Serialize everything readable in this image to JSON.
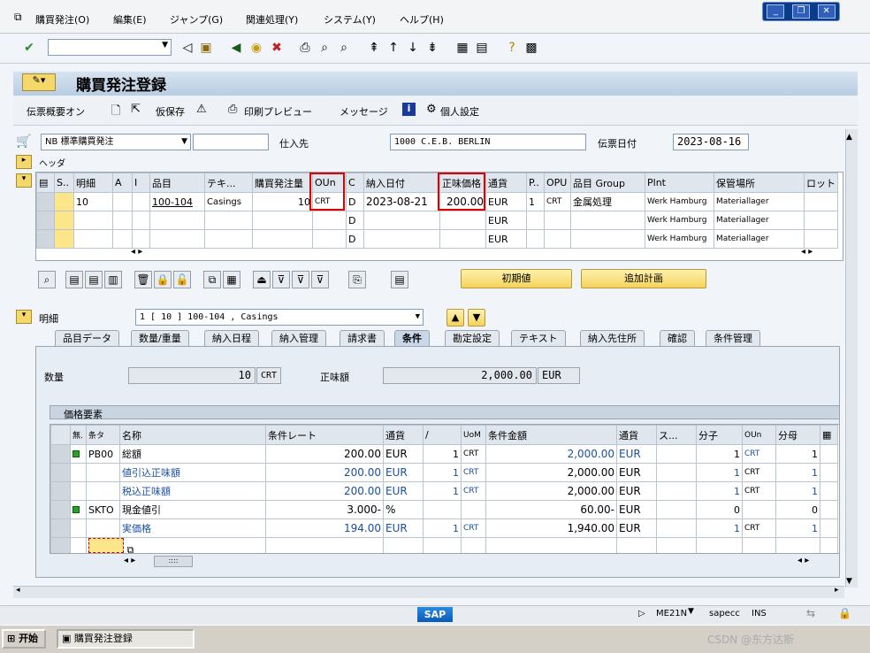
{
  "menu": [
    "購買発注(O)",
    "編集(E)",
    "ジャンプ(G)",
    "関連処理(Y)",
    "システム(Y)",
    "ヘルプ(H)"
  ],
  "title": "購買発注登録",
  "app_toolbar": {
    "overview": "伝票概要オン",
    "hold": "仮保存",
    "print_preview": "印刷プレビュー",
    "messages": "メッセージ",
    "personal": "個人設定"
  },
  "header": {
    "doc_type": "NB 標準購買発注",
    "vendor_label": "仕入先",
    "vendor": "1000 C.E.B. BERLIN",
    "date_label": "伝票日付",
    "date": "2023-08-16",
    "header_label": "ヘッダ"
  },
  "items": {
    "columns": [
      "S..",
      "明細",
      "A",
      "I",
      "品目",
      "テキ...",
      "購買発注量",
      "OUn",
      "C",
      "納入日付",
      "正味価格",
      "通貨",
      "P..",
      "OPU",
      "品目 Group",
      "Plnt",
      "保管場所",
      "ロット"
    ],
    "rows": [
      {
        "item": "10",
        "material": "100-104",
        "text": "Casings",
        "qty": "10",
        "oun": "CRT",
        "c": "D",
        "date": "2023-08-21",
        "price": "200.00",
        "cur": "EUR",
        "p": "1",
        "opu": "CRT",
        "group": "金属処理",
        "plant": "Werk Hamburg",
        "sloc": "Materiallager"
      },
      {
        "c": "D",
        "cur": "EUR",
        "plant": "Werk Hamburg",
        "sloc": "Materiallager"
      },
      {
        "c": "D",
        "cur": "EUR",
        "plant": "Werk Hamburg",
        "sloc": "Materiallager"
      }
    ]
  },
  "buttons": {
    "default": "初期値",
    "addplan": "追加計画"
  },
  "detail": {
    "label": "明細",
    "select": "1 [ 10 ] 100-104 , Casings"
  },
  "tabs": [
    "品目データ",
    "数量/重量",
    "納入日程",
    "納入管理",
    "請求書",
    "条件",
    "勘定設定",
    "テキスト",
    "納入先住所",
    "確認",
    "条件管理"
  ],
  "cond": {
    "qty_label": "数量",
    "qty": "10",
    "qty_unit": "CRT",
    "net_label": "正味額",
    "net": "2,000.00",
    "net_cur": "EUR",
    "price_elem_label": "価格要素",
    "columns": [
      "無.",
      "条タ",
      "名称",
      "条件レート",
      "通貨",
      "/",
      "UoM",
      "条件金額",
      "通貨",
      "ス...",
      "分子",
      "OUn",
      "分母"
    ],
    "rows": [
      {
        "ct": "PB00",
        "name": "総額",
        "rate": "200.00",
        "cur": "EUR",
        "per": "1",
        "uom": "CRT",
        "amt": "2,000.00",
        "cur2": "EUR",
        "num": "1",
        "oun": "CRT",
        "den": "1"
      },
      {
        "ct": "",
        "name": "値引込正味額",
        "rate": "200.00",
        "cur": "EUR",
        "per": "1",
        "uom": "CRT",
        "amt": "2,000.00",
        "cur2": "EUR",
        "num": "1",
        "oun": "CRT",
        "den": "1"
      },
      {
        "ct": "",
        "name": "税込正味額",
        "rate": "200.00",
        "cur": "EUR",
        "per": "1",
        "uom": "CRT",
        "amt": "2,000.00",
        "cur2": "EUR",
        "num": "1",
        "oun": "CRT",
        "den": "1"
      },
      {
        "ct": "SKTO",
        "name": "現金値引",
        "rate": "3.000-",
        "cur": "%",
        "per": "",
        "uom": "",
        "amt": "60.00-",
        "cur2": "EUR",
        "num": "0",
        "oun": "",
        "den": "0"
      },
      {
        "ct": "",
        "name": "実価格",
        "rate": "194.00",
        "cur": "EUR",
        "per": "1",
        "uom": "CRT",
        "amt": "1,940.00",
        "cur2": "EUR",
        "num": "1",
        "oun": "CRT",
        "den": "1"
      }
    ]
  },
  "status": {
    "tcode": "ME21N",
    "server": "sapecc",
    "mode": "INS",
    "brand": "SAP"
  },
  "taskbar": {
    "start": "开始",
    "window": "購買発注登録",
    "watermark": "CSDN @东方达斯"
  }
}
